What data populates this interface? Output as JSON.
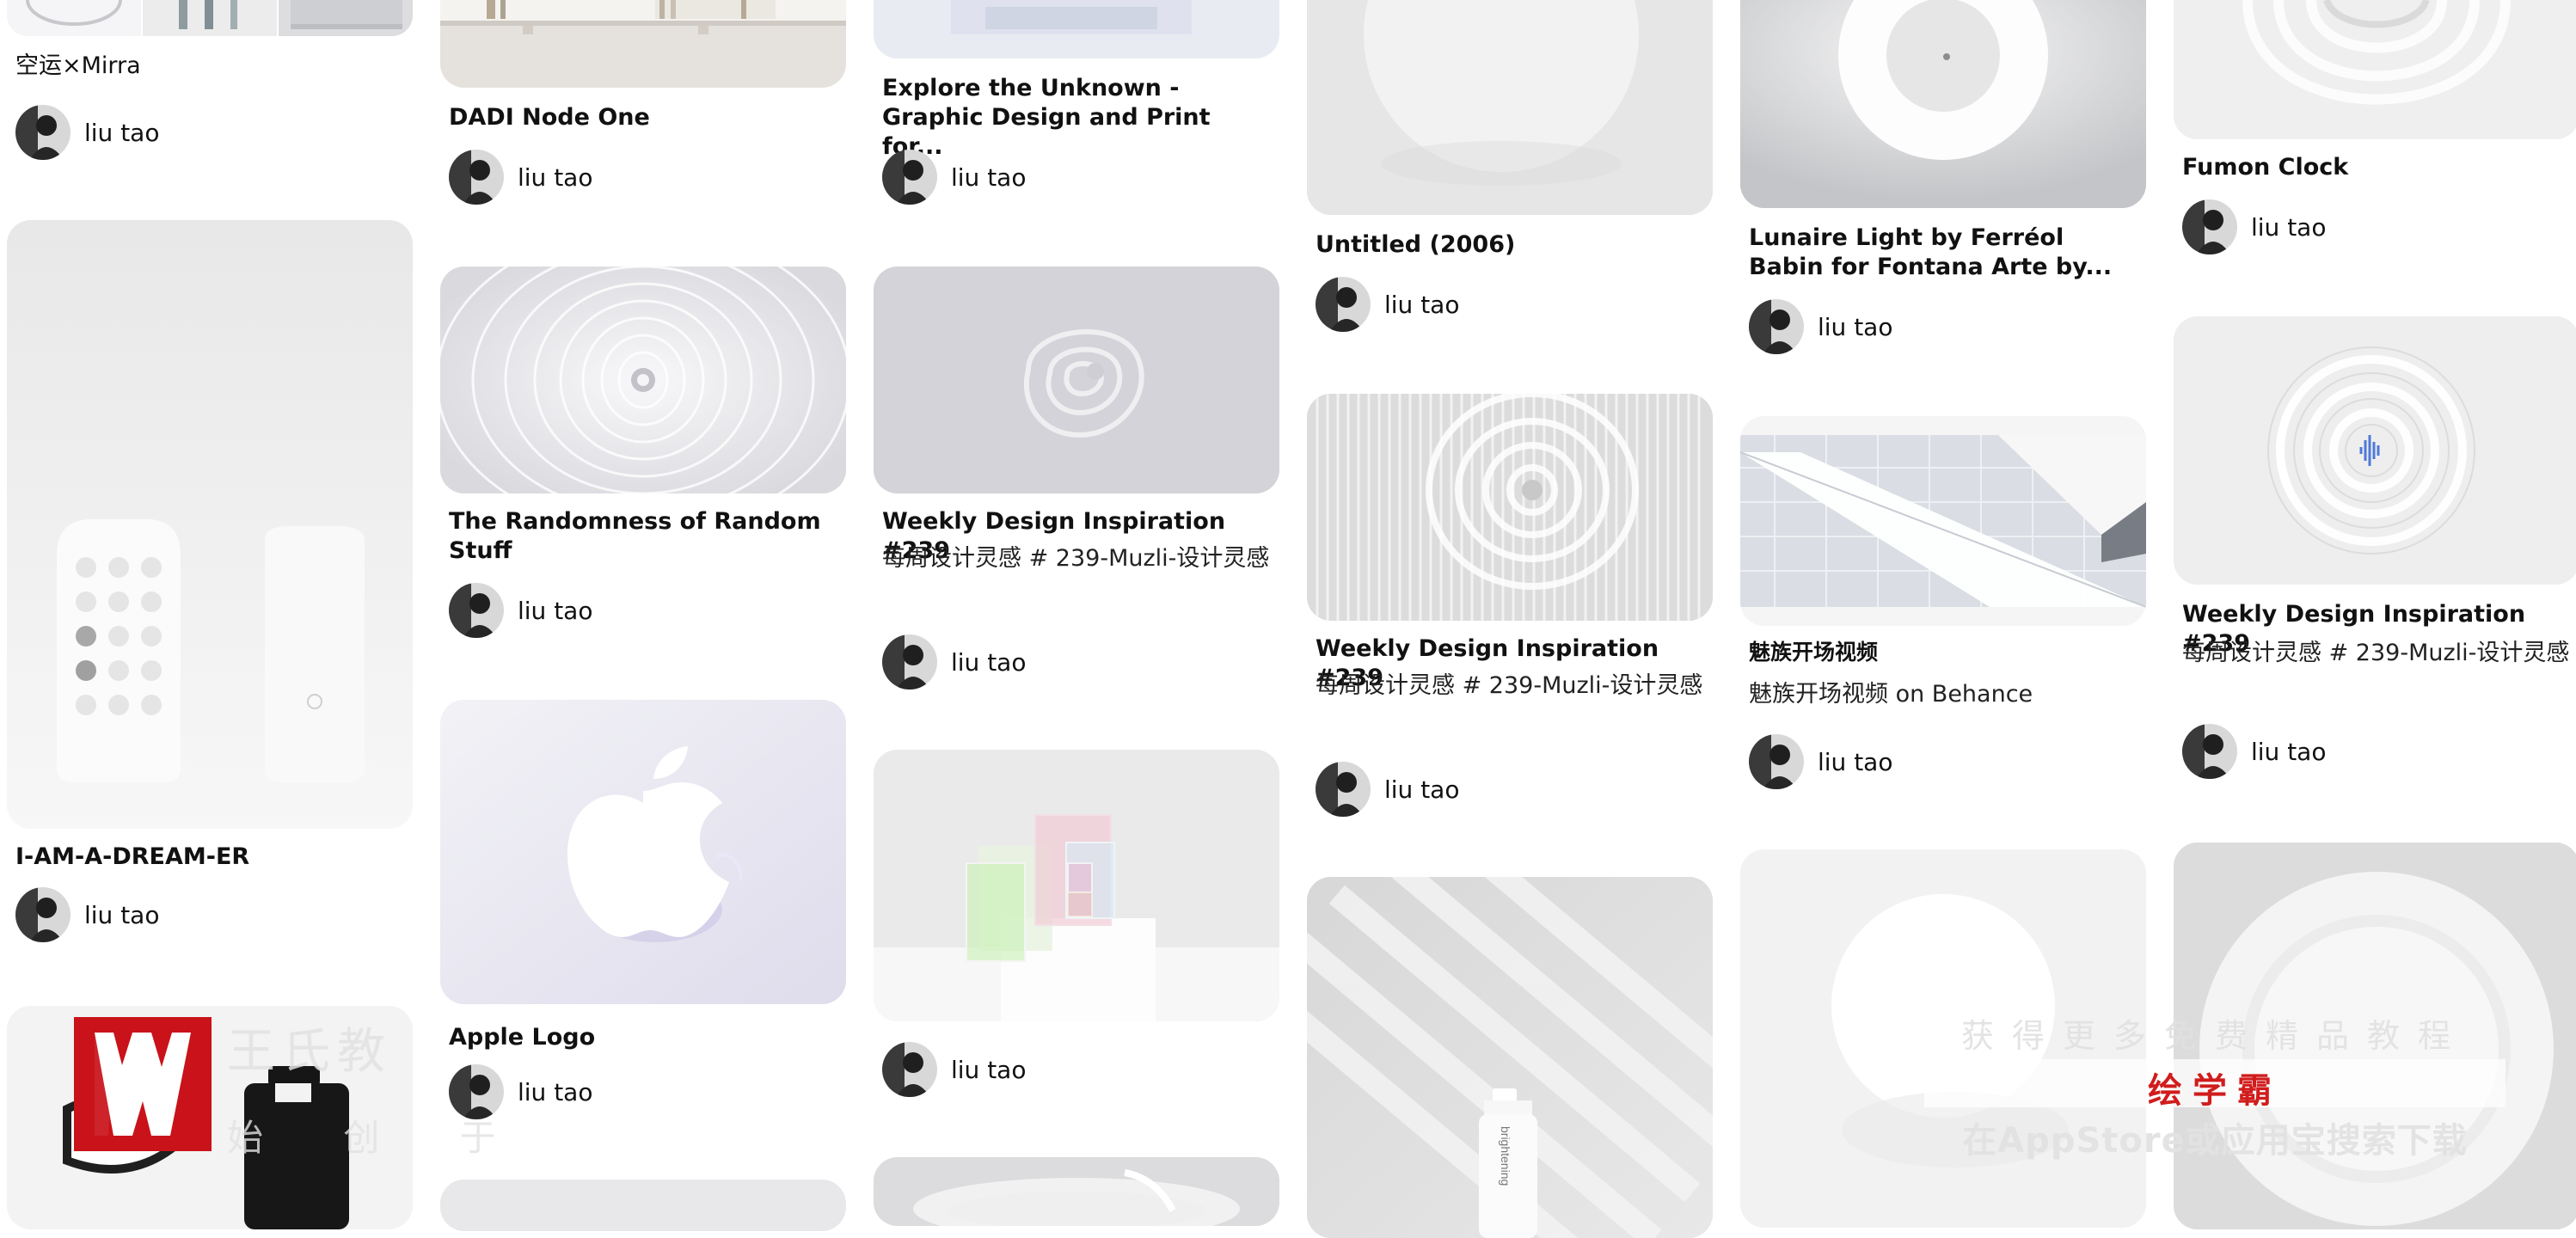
{
  "pins": [
    {
      "title": "空运×Mirra",
      "author": "liu tao"
    },
    {
      "title": "I-AM-A-DREAM-ER",
      "author": "liu tao"
    },
    {
      "title": "DADI Node One",
      "author": "liu tao"
    },
    {
      "title": "The Randomness of Random Stuff",
      "author": "liu tao"
    },
    {
      "title": "Apple Logo",
      "author": "liu tao"
    },
    {
      "title": "Explore the Unknown - Graphic Design and Print for...",
      "author": "liu tao"
    },
    {
      "title": "Weekly Design Inspiration #239",
      "description": "每周设计灵感 # 239-Muzli-设计灵感",
      "author": "liu tao"
    },
    {
      "author": "liu tao"
    },
    {
      "title": "Untitled (2006)",
      "author": "liu tao"
    },
    {
      "title": "Weekly Design Inspiration #239",
      "description": "每周设计灵感 # 239-Muzli-设计灵感",
      "author": "liu tao"
    },
    {
      "title": "Lunaire Light by Ferréol Babin for Fontana Arte by...",
      "author": "liu tao"
    },
    {
      "title": "魅族开场视频",
      "description": "魅族开场视频 on Behance",
      "author": "liu tao"
    },
    {
      "title": "Fumon Clock",
      "author": "liu tao"
    },
    {
      "title": "Weekly Design Inspiration #239",
      "description": "每周设计灵感 # 239-Muzli-设计灵感",
      "author": "liu tao"
    }
  ],
  "product_text": {
    "bottle_label": "brightening"
  },
  "watermark": {
    "brand_name": "王氏教",
    "slogan": "始 创 于",
    "promo_top": "获得更多免费精品教程",
    "promo_app": "绘学霸",
    "promo_bottom": "在AppStore或应用宝搜索下载"
  }
}
